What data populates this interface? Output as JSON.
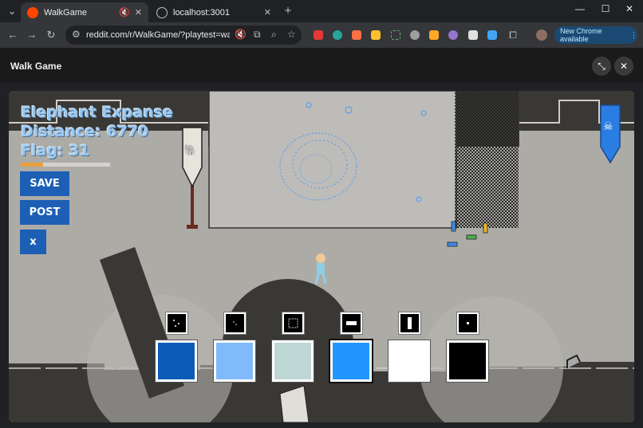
{
  "browser": {
    "tabs": [
      {
        "title": "WalkGame",
        "favicon_color": "#ff4500",
        "active": true
      },
      {
        "title": "localhost:3001",
        "active": false
      }
    ],
    "url": "reddit.com/r/WalkGame/?playtest=walk...",
    "new_chrome_label": "New Chrome available"
  },
  "app": {
    "title": "Walk Game"
  },
  "game": {
    "area_name": "Elephant Expanse",
    "distance_text": "Distance: 6770",
    "flag_text": "Flag: 31",
    "progress_fraction": 0.25,
    "buttons": {
      "save": "SAVE",
      "post": "POST",
      "close": "x"
    },
    "patterns": [
      "dots-sparse",
      "dots-tiny",
      "cross-hatch",
      "horizontal-bar",
      "vertical-bar",
      "center-dot"
    ],
    "colors": [
      {
        "hex": "#0a5cb8",
        "selected": false
      },
      {
        "hex": "#7fbbfb",
        "selected": false
      },
      {
        "hex": "#bfd7d4",
        "selected": false
      },
      {
        "hex": "#2196ff",
        "selected": true
      },
      {
        "hex": "#ffffff",
        "selected": false
      },
      {
        "hex": "#000000",
        "selected": false
      }
    ],
    "flags": [
      {
        "icon": "elephant-icon"
      },
      {
        "icon": "skull-icon"
      }
    ]
  }
}
